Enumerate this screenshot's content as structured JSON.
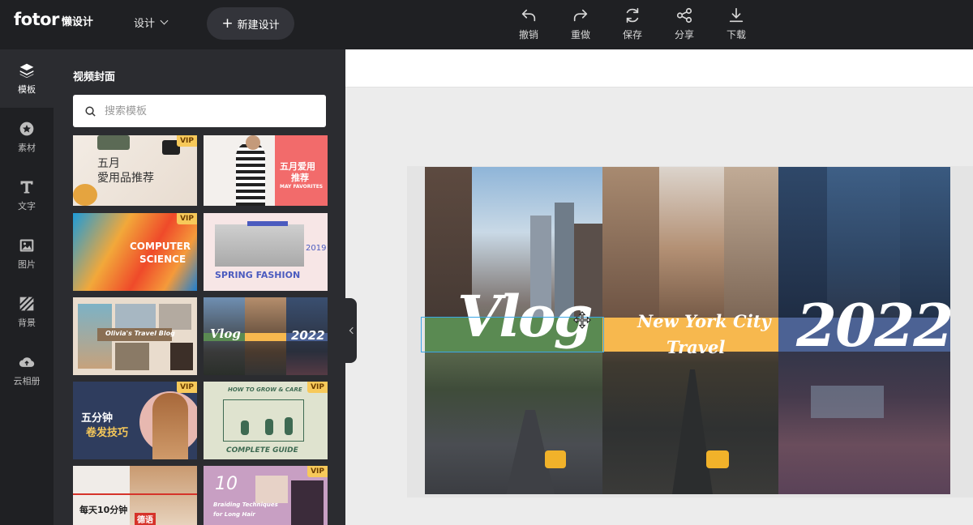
{
  "app": {
    "logo": "fotor",
    "logo_suffix": "懒设计",
    "design_menu": "设计",
    "new_design": "新建设计"
  },
  "toolbar": {
    "undo": "撤销",
    "redo": "重做",
    "save": "保存",
    "share": "分享",
    "download": "下载"
  },
  "rail": [
    {
      "label": "模板",
      "icon": "layers-icon"
    },
    {
      "label": "素材",
      "icon": "star-icon"
    },
    {
      "label": "文字",
      "icon": "text-icon"
    },
    {
      "label": "图片",
      "icon": "image-icon"
    },
    {
      "label": "背景",
      "icon": "background-icon"
    },
    {
      "label": "云相册",
      "icon": "cloud-upload-icon"
    }
  ],
  "panel": {
    "title": "视频封面",
    "search_placeholder": "搜索模板"
  },
  "templates": {
    "t1": {
      "line1": "五月",
      "line2": "愛用品推荐",
      "vip": "VIP"
    },
    "t2": {
      "line1": "五月爱用",
      "line2": "推荐",
      "line3": "MAY FAVORITES"
    },
    "t3": {
      "line1": "COMPUTER",
      "line2": "SCIENCE",
      "vip": "VIP"
    },
    "t4": {
      "line1": "SPRING FASHION",
      "line2": "2019"
    },
    "t5": {
      "line1": "Olivia's Travel Blog"
    },
    "t6": {
      "line1": "Vlog",
      "line2": "2022"
    },
    "t7": {
      "line1": "五分钟",
      "line2": "卷发技巧",
      "vip": "VIP"
    },
    "t8": {
      "line1": "HOW TO GROW & CARE",
      "line2": "COMPLETE GUIDE",
      "vip": "VIP"
    },
    "t9": {
      "line1": "每天10分钟",
      "line2": "德语"
    },
    "t10": {
      "line1": "10",
      "line2": "Braiding Techniques",
      "line3": "for Long Hair",
      "vip": "VIP"
    }
  },
  "design": {
    "word1": "Vlog",
    "word2_line1": "New York City",
    "word2_line2": "Travel",
    "word3": "2022"
  },
  "colors": {
    "topbar": "#1f2023",
    "panel": "#2b2c30",
    "band_green": "#5a8a52",
    "band_yellow": "#f7b84e",
    "band_blue": "#4c6294",
    "selection": "#3aa7e6"
  }
}
